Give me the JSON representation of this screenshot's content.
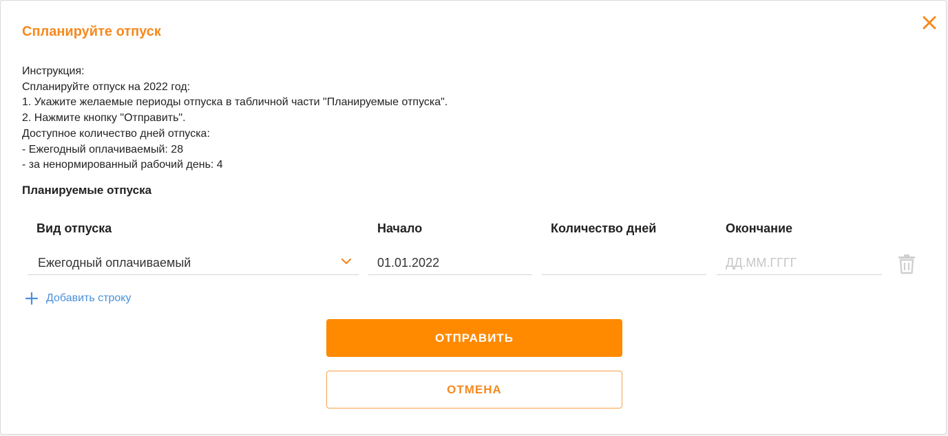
{
  "dialog": {
    "title": "Спланируйте отпуск",
    "close_icon": "close-icon"
  },
  "instructions": [
    "Инструкция:",
    "Спланируйте отпуск на 2022 год:",
    "1. Укажите желаемые периоды отпуска в табличной части \"Планируемые отпуска\".",
    "2. Нажмите кнопку \"Отправить\".",
    "Доступное количество дней отпуска:",
    "- Ежегодный оплачиваемый: 28",
    "- за ненормированный рабочий день: 4"
  ],
  "table": {
    "section_title": "Планируемые отпуска",
    "columns": [
      "Вид отпуска",
      "Начало",
      "Количество дней",
      "Окончание"
    ],
    "rows": [
      {
        "vacation_type": "Ежегодный оплачиваемый",
        "start": "01.01.2022",
        "days": "",
        "end_placeholder": "ДД.ММ.ГГГГ"
      }
    ],
    "add_row_label": "Добавить строку"
  },
  "buttons": {
    "submit": "ОТПРАВИТЬ",
    "cancel": "ОТМЕНА"
  },
  "colors": {
    "accent": "#ff8a00",
    "title": "#f5891f",
    "link": "#4a90d9"
  }
}
